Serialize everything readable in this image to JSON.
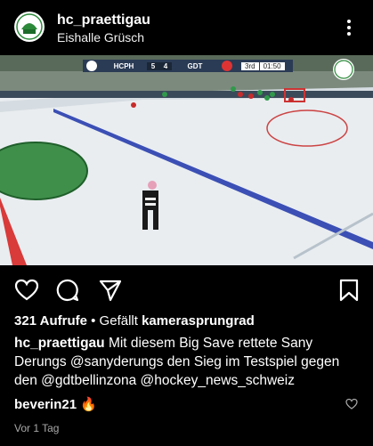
{
  "post": {
    "username": "hc_praettigau",
    "location": "Eishalle Grüsch",
    "avatar_icon": "club-logo-icon"
  },
  "scoreboard": {
    "home_team": "HCPH",
    "home_score": "5",
    "away_score": "4",
    "away_team": "GDT",
    "period": "3rd",
    "clock": "01:50"
  },
  "stats": {
    "views": "321 Aufrufe",
    "liked_prefix": " • Gefällt ",
    "liked_user": "kamerasprungrad"
  },
  "caption": {
    "username": "hc_praettigau",
    "text": " Mit diesem Big Save rettete Sany Derungs @sanyderungs  den Sieg im Testspiel gegen den @gdtbellinzona @hockey_news_schweiz"
  },
  "comment": {
    "username": "beverin21",
    "text": " 🔥"
  },
  "time_ago": "Vor 1 Tag",
  "colors": {
    "background": "#000000",
    "text": "#ffffff",
    "muted": "#a8a8a8",
    "rink": "#e9edf0",
    "blue_line": "#3b4fb5",
    "scorebar": "#2a3b55"
  }
}
